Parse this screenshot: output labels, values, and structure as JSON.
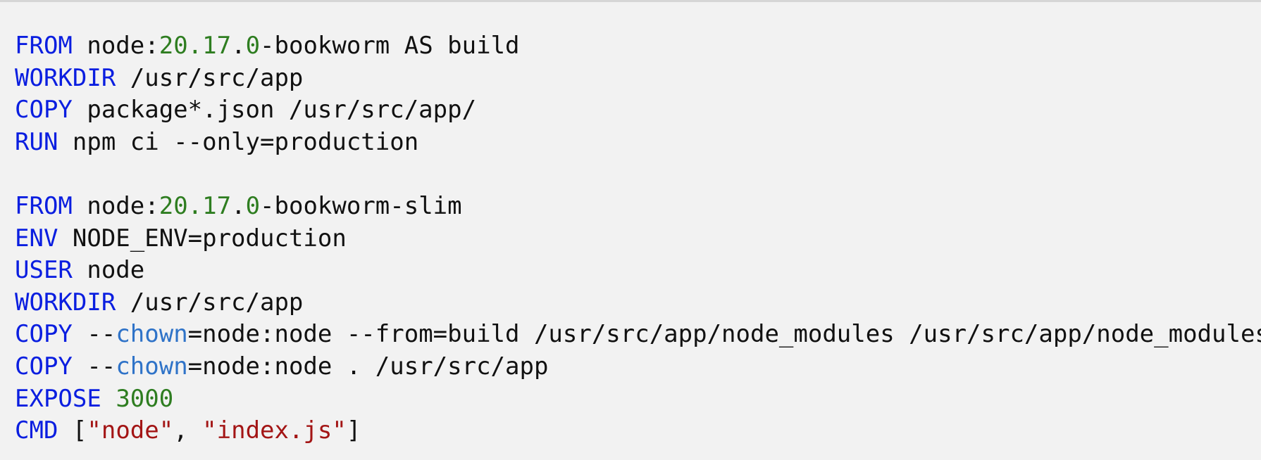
{
  "colors": {
    "keyword": "#0a1ee0",
    "number": "#2e7d20",
    "string": "#a31515",
    "flag": "#2f73c8",
    "text": "#111111",
    "background": "#f2f2f2"
  },
  "code": {
    "lines": [
      [
        {
          "t": "FROM",
          "c": "kw"
        },
        {
          "t": " node:",
          "c": "plain"
        },
        {
          "t": "20.17",
          "c": "num"
        },
        {
          "t": ".",
          "c": "plain"
        },
        {
          "t": "0",
          "c": "num"
        },
        {
          "t": "-bookworm AS build",
          "c": "plain"
        }
      ],
      [
        {
          "t": "WORKDIR",
          "c": "kw"
        },
        {
          "t": " /usr/src/app",
          "c": "plain"
        }
      ],
      [
        {
          "t": "COPY",
          "c": "kw"
        },
        {
          "t": " package*.json /usr/src/app/",
          "c": "plain"
        }
      ],
      [
        {
          "t": "RUN",
          "c": "kw"
        },
        {
          "t": " npm ci --only=production",
          "c": "plain"
        }
      ],
      [
        {
          "t": "",
          "c": "plain"
        }
      ],
      [
        {
          "t": "FROM",
          "c": "kw"
        },
        {
          "t": " node:",
          "c": "plain"
        },
        {
          "t": "20.17",
          "c": "num"
        },
        {
          "t": ".",
          "c": "plain"
        },
        {
          "t": "0",
          "c": "num"
        },
        {
          "t": "-bookworm-slim",
          "c": "plain"
        }
      ],
      [
        {
          "t": "ENV",
          "c": "kw"
        },
        {
          "t": " NODE_ENV=production",
          "c": "plain"
        }
      ],
      [
        {
          "t": "USER",
          "c": "kw"
        },
        {
          "t": " node",
          "c": "plain"
        }
      ],
      [
        {
          "t": "WORKDIR",
          "c": "kw"
        },
        {
          "t": " /usr/src/app",
          "c": "plain"
        }
      ],
      [
        {
          "t": "COPY",
          "c": "kw"
        },
        {
          "t": " --",
          "c": "plain"
        },
        {
          "t": "chown",
          "c": "flag"
        },
        {
          "t": "=node:node --from=build /usr/src/app/node_modules /usr/src/app/node_modules",
          "c": "plain"
        }
      ],
      [
        {
          "t": "COPY",
          "c": "kw"
        },
        {
          "t": " --",
          "c": "plain"
        },
        {
          "t": "chown",
          "c": "flag"
        },
        {
          "t": "=node:node . /usr/src/app",
          "c": "plain"
        }
      ],
      [
        {
          "t": "EXPOSE",
          "c": "kw"
        },
        {
          "t": " ",
          "c": "plain"
        },
        {
          "t": "3000",
          "c": "num"
        }
      ],
      [
        {
          "t": "CMD",
          "c": "kw"
        },
        {
          "t": " [",
          "c": "plain"
        },
        {
          "t": "\"node\"",
          "c": "str"
        },
        {
          "t": ", ",
          "c": "plain"
        },
        {
          "t": "\"index.js\"",
          "c": "str"
        },
        {
          "t": "]",
          "c": "plain"
        }
      ]
    ]
  }
}
